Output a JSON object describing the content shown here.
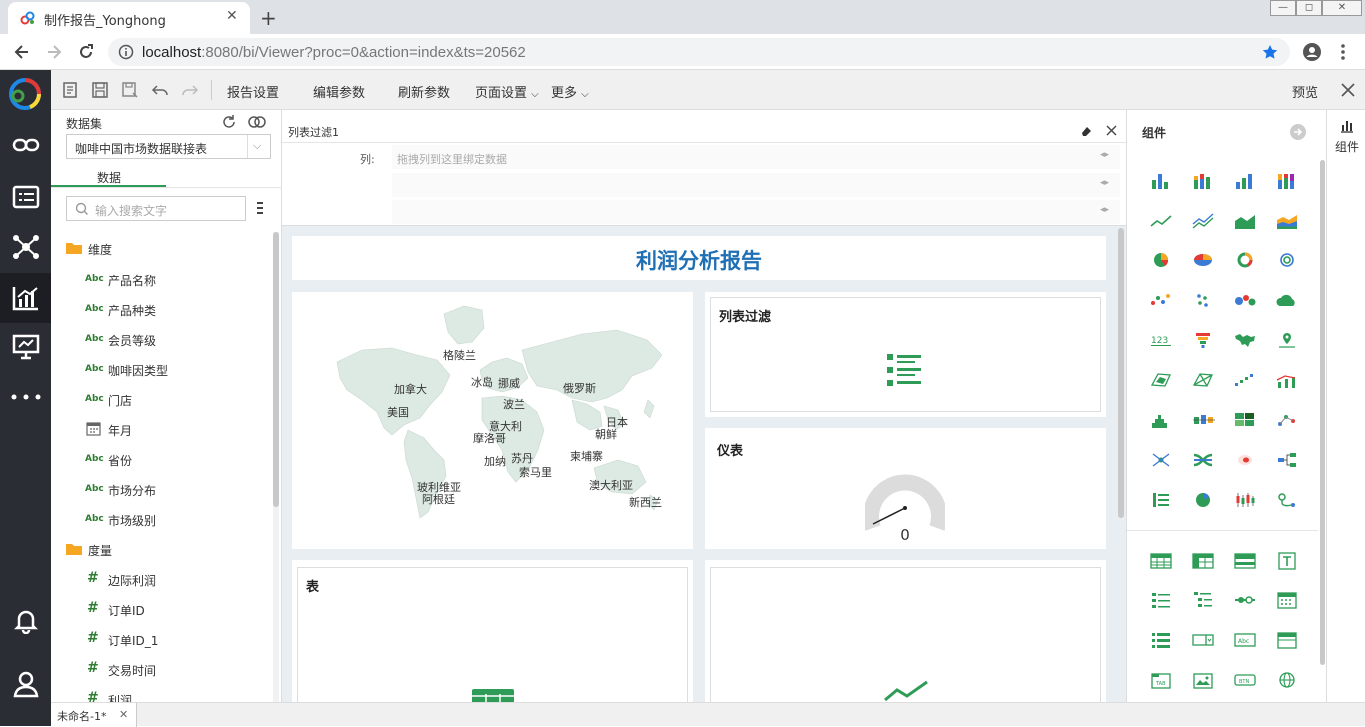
{
  "browser": {
    "tab_title": "制作报告_Yonghong",
    "new_tab": "+",
    "url_host": "localhost",
    "url_rest": ":8080/bi/Viewer?proc=0&action=index&ts=20562",
    "win_min": "—",
    "win_max": "◻",
    "win_close": "✕"
  },
  "toolbar": {
    "report_settings": "报告设置",
    "edit_params": "编辑参数",
    "refresh_params": "刷新参数",
    "page_settings": "页面设置",
    "more": "更多",
    "preview": "预览"
  },
  "datapanel": {
    "dataset_label": "数据集",
    "dataset_value": "咖啡中国市场数据联接表",
    "tab_data": "数据",
    "search_placeholder": "输入搜索文字",
    "dimension_folder": "维度",
    "measure_folder": "度量",
    "dimensions": [
      "产品名称",
      "产品种类",
      "会员等级",
      "咖啡因类型",
      "门店",
      "年月",
      "省份",
      "市场分布",
      "市场级别"
    ],
    "measures": [
      "边际利润",
      "订单ID",
      "订单ID_1",
      "交易时间",
      "利润"
    ],
    "abc": "Abc"
  },
  "filter": {
    "title": "列表过滤1",
    "col_label": "列:",
    "drop_placeholder": "拖拽列到这里绑定数据"
  },
  "report": {
    "title": "利润分析报告",
    "list_filter_title": "列表过滤",
    "gauge_title": "仪表",
    "gauge_value": "0",
    "table_title": "表",
    "map_labels": [
      "格陵兰",
      "加拿大",
      "冰岛",
      "挪威",
      "俄罗斯",
      "美国",
      "波兰",
      "意大利",
      "日本",
      "摩洛哥",
      "朝鲜",
      "加纳",
      "苏丹",
      "柬埔寨",
      "索马里",
      "玻利维亚",
      "澳大利亚",
      "阿根廷",
      "新西兰"
    ]
  },
  "components": {
    "title": "组件",
    "strip_label": "组件"
  },
  "bottom": {
    "sheet_tab": "未命名-1*",
    "close": "✕"
  },
  "colors": {
    "accent_green": "#2e9c57",
    "title_blue": "#1f6fb4",
    "nav_dark": "#2b2d35"
  }
}
